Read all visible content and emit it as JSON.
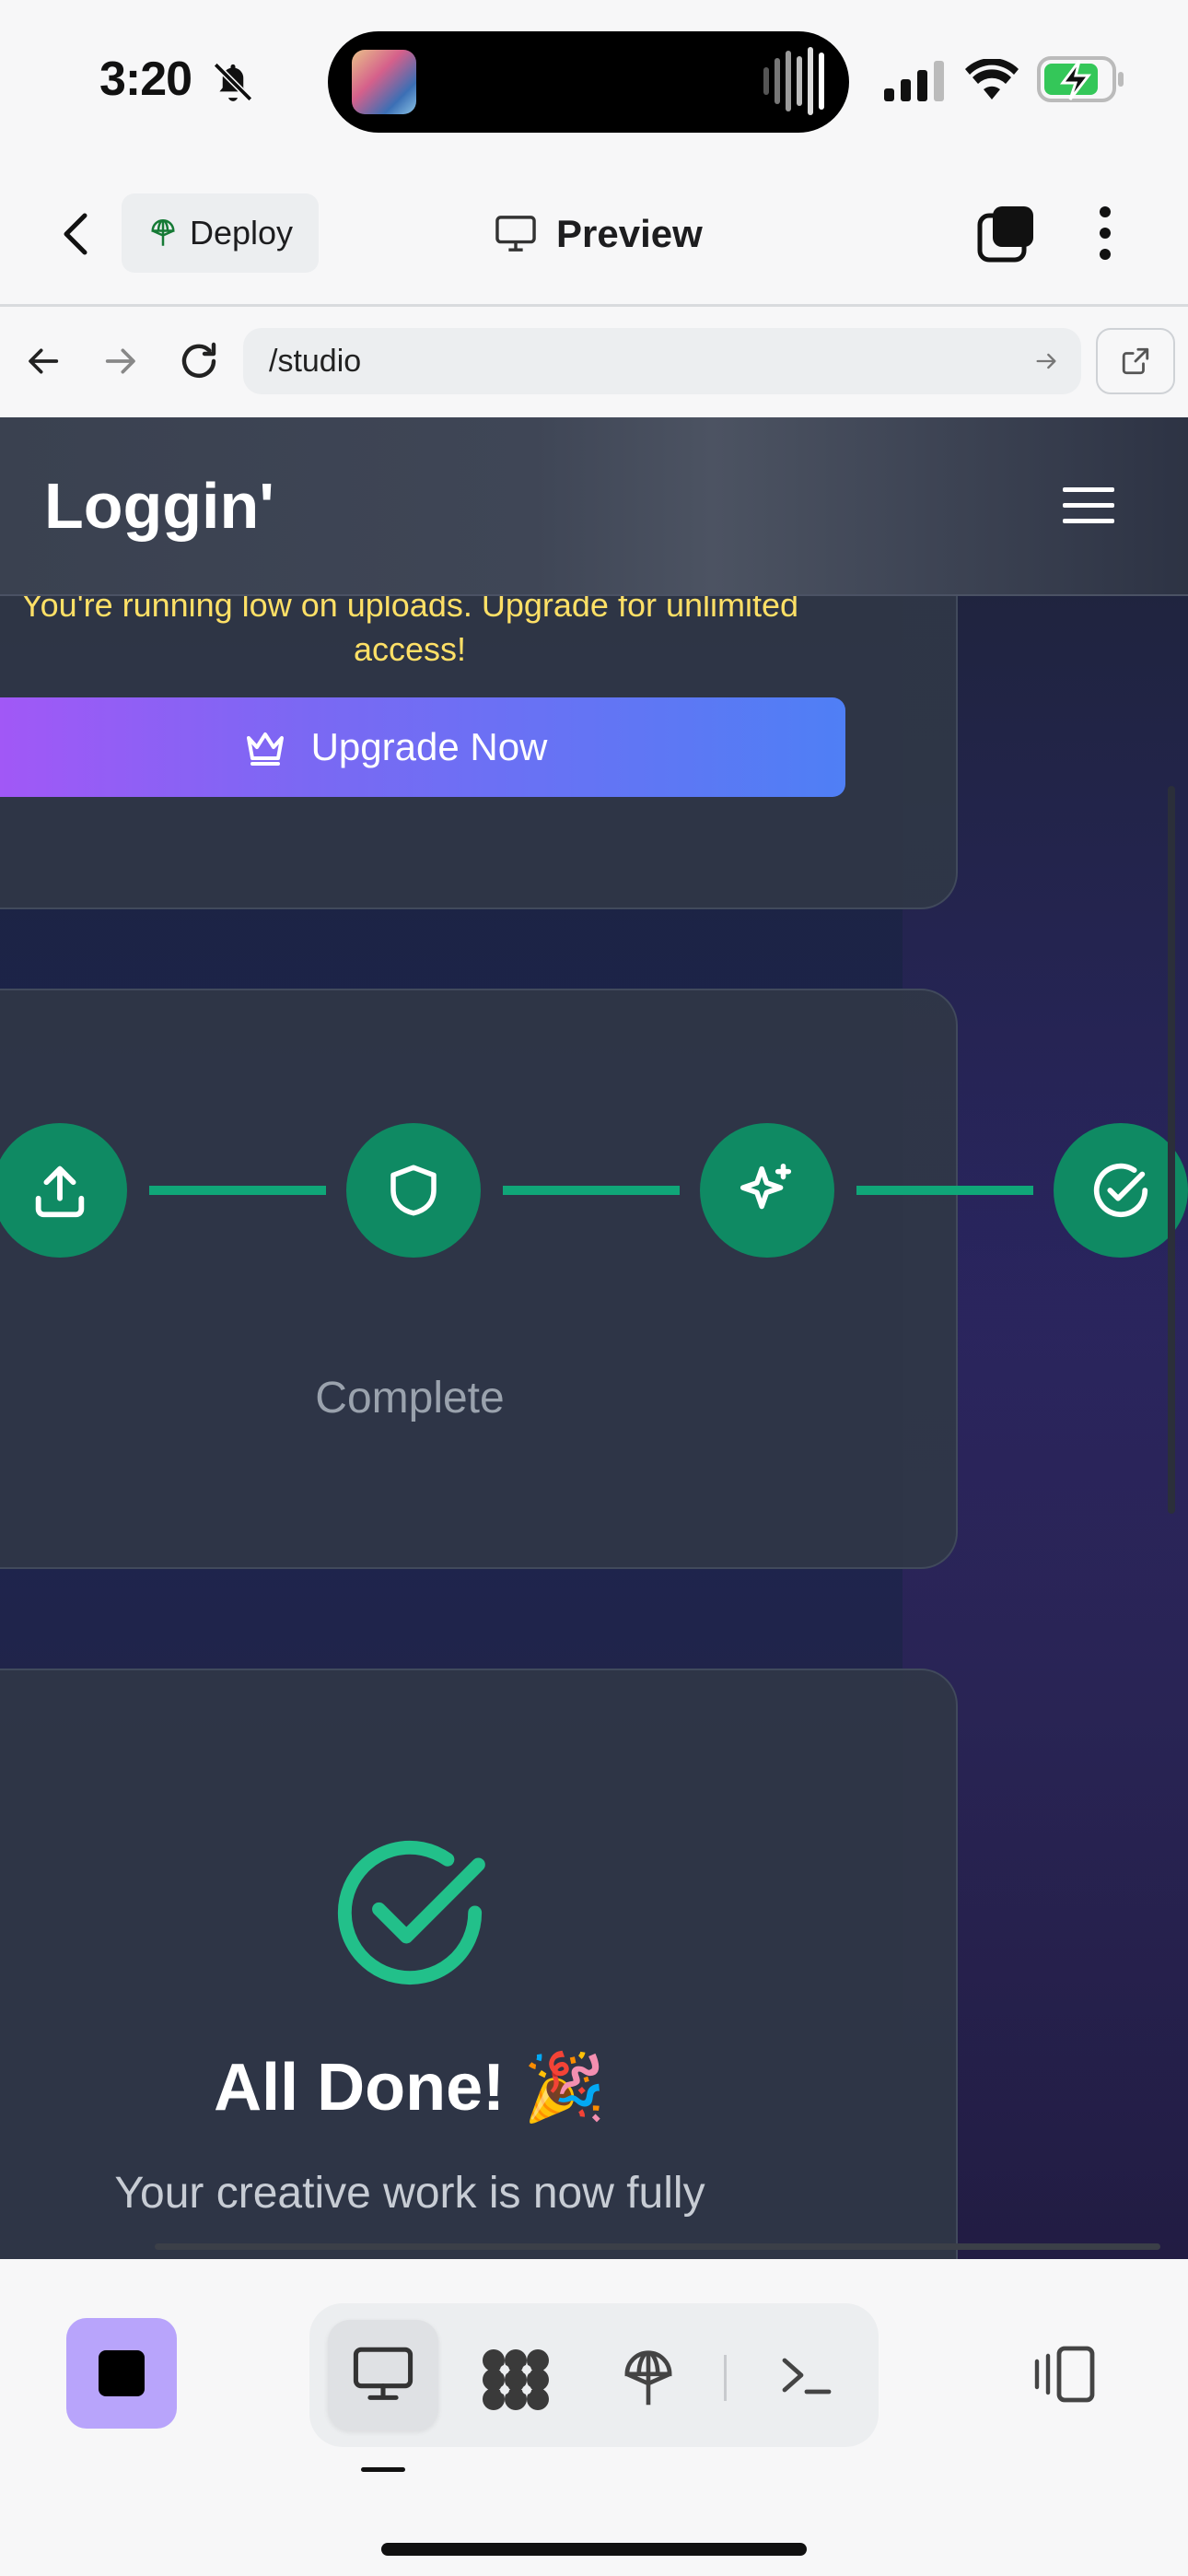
{
  "status_bar": {
    "time": "3:20"
  },
  "app_header": {
    "deploy_label": "Deploy",
    "title": "Preview"
  },
  "browser": {
    "url": "/studio"
  },
  "site": {
    "logo": "Loggin'",
    "warning_text": "You're running low on uploads. Upgrade for unlimited access!",
    "upgrade_label": "Upgrade Now",
    "progress_steps": [
      "upload-icon",
      "shield-icon",
      "sparkles-icon",
      "check-circle-icon"
    ],
    "step_label": "Complete",
    "done_title": "All Done! 🎉",
    "done_text": "Your creative work is now fully"
  },
  "colors": {
    "accent_purple": "#a855f7",
    "accent_blue": "#4f7ff5",
    "step_green": "#0f8a63",
    "success_green": "#22c08a",
    "warning_yellow": "#ffe066",
    "stop_button": "#b8a4fb"
  },
  "toolbar": {
    "active_tool": "desktop-preview"
  }
}
